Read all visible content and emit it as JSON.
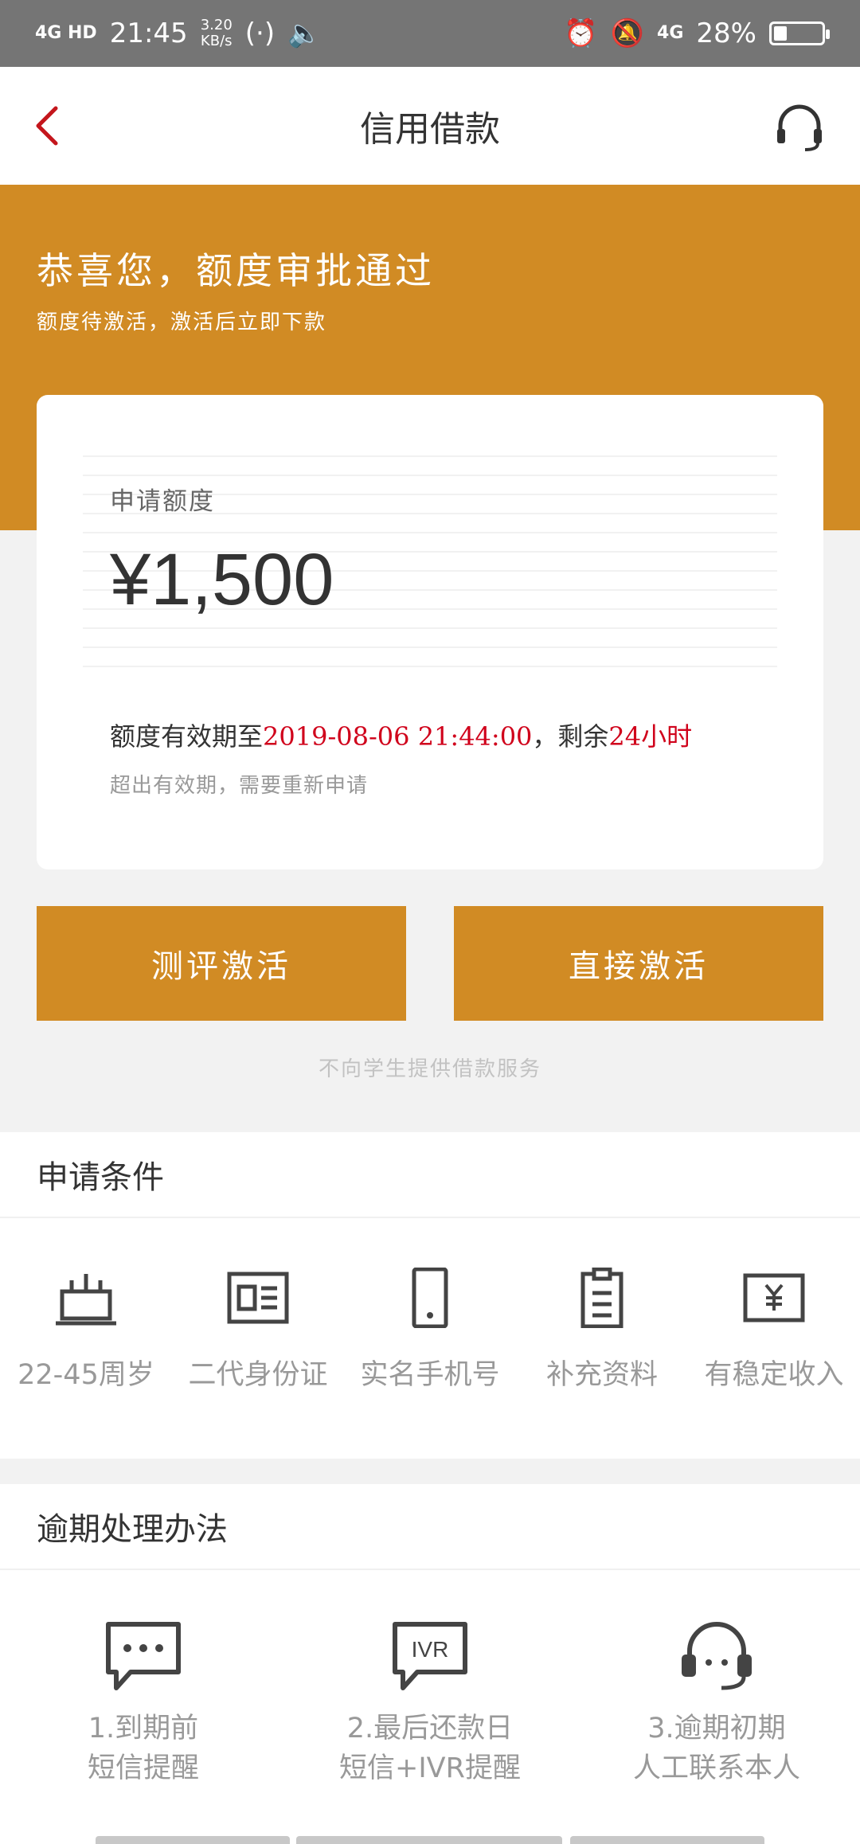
{
  "status_bar": {
    "network": "4G HD",
    "time": "21:45",
    "speed_value": "3.20",
    "speed_unit": "KB/s",
    "network_right": "4G",
    "battery": "28%",
    "battery_level": 0.28
  },
  "nav": {
    "title": "信用借款",
    "back_icon": "chevron-left-icon",
    "support_icon": "headset-icon"
  },
  "hero": {
    "title": "恭喜您，额度审批通过",
    "subtitle": "额度待激活，激活后立即下款"
  },
  "card": {
    "label": "申请额度",
    "amount": "¥1,500",
    "valid_prefix": "额度有效期至",
    "valid_date": "2019-08-06 21:44:00",
    "valid_mid": "，剩余",
    "valid_remaining": "24小时",
    "note": "超出有效期，需要重新申请"
  },
  "buttons": {
    "evaluate": "测评激活",
    "direct": "直接激活"
  },
  "disclaimer": "不向学生提供借款服务",
  "conditions": {
    "title": "申请条件",
    "items": [
      {
        "label": "22-45周岁",
        "icon": "cake-icon"
      },
      {
        "label": "二代身份证",
        "icon": "id-card-icon"
      },
      {
        "label": "实名手机号",
        "icon": "phone-icon"
      },
      {
        "label": "补充资料",
        "icon": "clipboard-icon"
      },
      {
        "label": "有稳定收入",
        "icon": "income-icon"
      }
    ]
  },
  "overdue": {
    "title": "逾期处理办法",
    "items": [
      {
        "line1": "1.到期前",
        "line2": "短信提醒",
        "icon": "chat-icon"
      },
      {
        "line1": "2.最后还款日",
        "line2": "短信+IVR提醒",
        "icon": "ivr-icon"
      },
      {
        "line1": "3.逾期初期",
        "line2": "人工联系本人",
        "icon": "headset-icon"
      }
    ]
  },
  "colors": {
    "accent": "#d18b24",
    "highlight_red": "#d0021b",
    "status_bar": "#757575"
  }
}
